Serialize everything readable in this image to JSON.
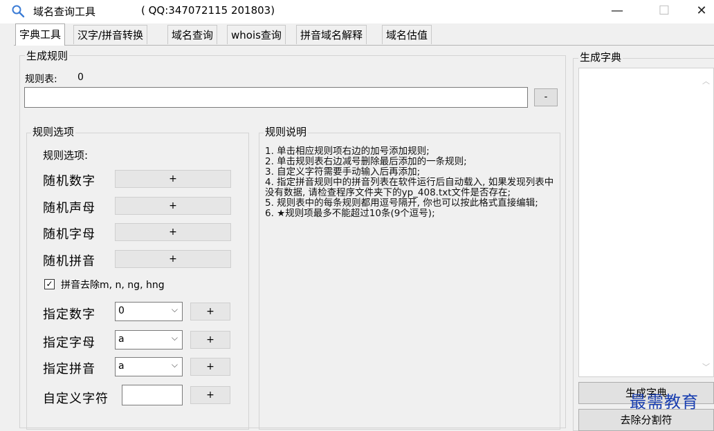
{
  "window": {
    "title": "域名查询工具",
    "subtitle": "( QQ:347072115    201803)",
    "min": "—",
    "max": "☐",
    "close": "✕"
  },
  "tabs": [
    "字典工具",
    "汉字/拼音转换",
    "域名查询",
    "whois查询",
    "拼音域名解释",
    "域名估值"
  ],
  "rules": {
    "group_title": "生成规则",
    "count_label": "规则表:",
    "count_value": "0",
    "rule_input_value": "",
    "remove_label": "-"
  },
  "options": {
    "group_title": "规则选项",
    "header": "规则选项:",
    "random_items": [
      {
        "label": "随机数字",
        "btn": "+"
      },
      {
        "label": "随机声母",
        "btn": "+"
      },
      {
        "label": "随机字母",
        "btn": "+"
      },
      {
        "label": "随机拼音",
        "btn": "+"
      }
    ],
    "checkbox_label": "拼音去除m, n, ng, hng",
    "checkbox_checked": true,
    "specified_items": [
      {
        "label": "指定数字",
        "value": "0",
        "btn": "+"
      },
      {
        "label": "指定字母",
        "value": "a",
        "btn": "+"
      },
      {
        "label": "指定拼音",
        "value": "a",
        "btn": "+"
      }
    ],
    "custom_label": "自定义字符",
    "custom_value": "",
    "custom_btn": "+"
  },
  "notes": {
    "group_title": "规则说明",
    "lines": [
      "1. 单击相应规则项右边的加号添加规则;",
      "2. 单击规则表右边减号删除最后添加的一条规则;",
      "3. 自定义字符需要手动输入后再添加;",
      "4. 指定拼音规则中的拼音列表在软件运行后自动载入, 如果发现列表中没有数据, 请检查程序文件夹下的yp_408.txt文件是否存在;",
      "5. 规则表中的每条规则都用逗号隔开, 你也可以按此格式直接编辑;",
      "6. ★规则项最多不能超过10条(9个逗号);"
    ]
  },
  "dictionary": {
    "group_title": "生成字典",
    "generate_btn": "生成字典",
    "remove_sep_btn": "去除分割符"
  },
  "watermark": "最需教育"
}
